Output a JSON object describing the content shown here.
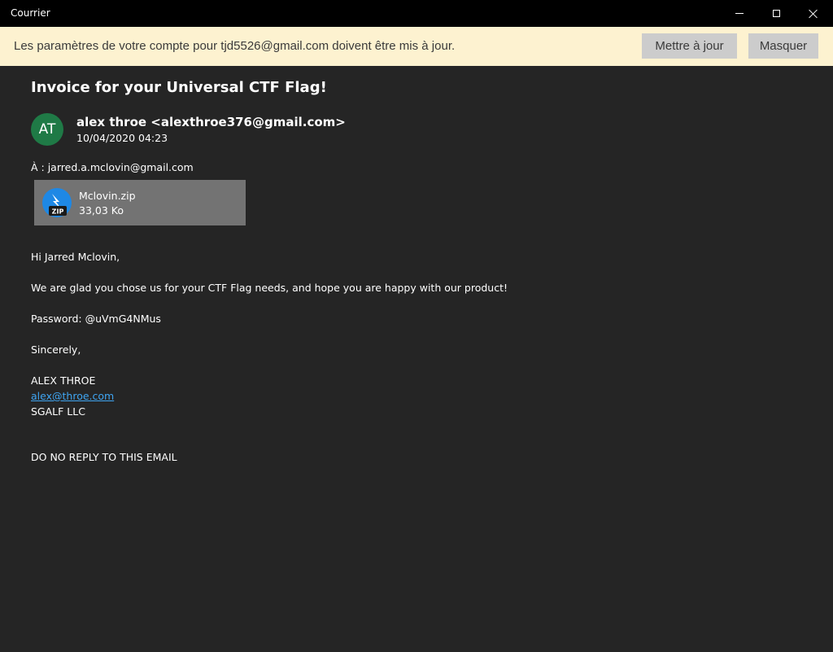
{
  "window": {
    "title": "Courrier",
    "controls": [
      "minimize",
      "maximize",
      "close"
    ]
  },
  "banner": {
    "message": "Les paramètres de votre compte pour tjd5526@gmail.com doivent être mis à jour.",
    "update_label": "Mettre à jour",
    "hide_label": "Masquer"
  },
  "email": {
    "subject": "Invoice for your Universal CTF Flag!",
    "avatar_initials": "AT",
    "avatar_color": "#1f7a46",
    "sender": "alex throe <alexthroe376@gmail.com>",
    "date": "10/04/2020 04:23",
    "to": "À : jarred.a.mclovin@gmail.com",
    "attachment": {
      "name": "Mclovin.zip",
      "size": "33,03 Ko",
      "icon": "zip-file-icon",
      "icon_label": "ZIP"
    },
    "body": {
      "greeting": "Hi Jarred Mclovin,",
      "paragraph": "We are glad you chose us for your CTF Flag needs, and hope you are happy with our product!",
      "password": "Password: @uVmG4NMus",
      "closing": "Sincerely,",
      "signature_name": "ALEX THROE",
      "signature_email": "alex@throe.com",
      "signature_company": "SGALF LLC",
      "footer": "DO NO REPLY TO THIS EMAIL"
    }
  },
  "colors": {
    "titlebar": "#000000",
    "banner_bg": "#fdf2d0",
    "content_bg": "#252525",
    "link": "#3fa5f2",
    "attachment_bg": "#737373"
  }
}
